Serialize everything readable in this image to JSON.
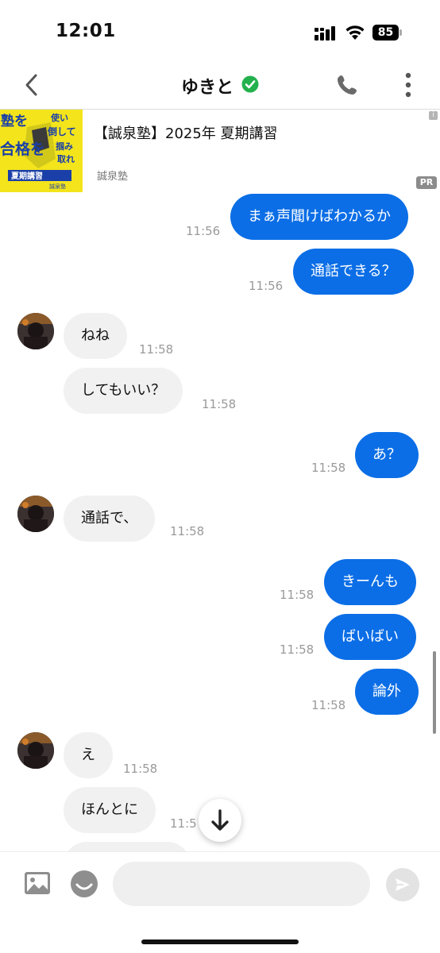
{
  "status_bar": {
    "time": "12:01",
    "battery": "85"
  },
  "header": {
    "title": "ゆきと"
  },
  "ad": {
    "title": "【誠泉塾】2025年 夏期講習",
    "sponsor": "誠泉塾",
    "badge": "PR",
    "info": "i",
    "image_text": {
      "line1": "塾を",
      "line2": "使い",
      "line3": "倒して",
      "line4": "合格を",
      "line5": "掴み",
      "line6": "取れ",
      "line7": "夏期講習",
      "line8": "誠泉塾"
    }
  },
  "messages": [
    {
      "text": "まぁ声聞けばわかるか",
      "time": "11:56"
    },
    {
      "text": "通話できる？",
      "time": "11:56"
    },
    {
      "text": "ねね",
      "time": "11:58"
    },
    {
      "text": "してもいい？",
      "time": "11:58"
    },
    {
      "text": "あ？",
      "time": "11:58"
    },
    {
      "text": "通話で、",
      "time": "11:58"
    },
    {
      "text": "きーんも",
      "time": "11:58"
    },
    {
      "text": "ばいばい",
      "time": "11:58"
    },
    {
      "text": "論外",
      "time": "11:58"
    },
    {
      "text": "え",
      "time": "11:58"
    },
    {
      "text": "ほんとに",
      "time": "11:5"
    }
  ],
  "composer": {
    "placeholder": ""
  },
  "colors": {
    "accent": "#0b6ee6",
    "verified": "#22b14c",
    "incoming": "#f1f1f1"
  }
}
